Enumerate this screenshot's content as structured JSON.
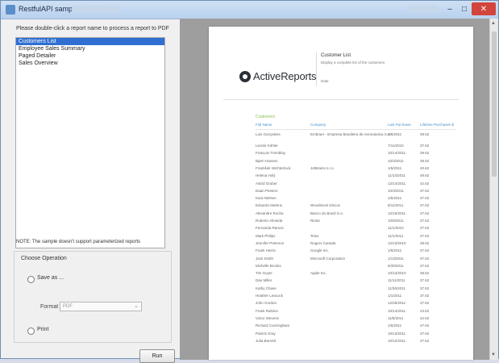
{
  "window": {
    "title": "RestfulAPI sample"
  },
  "left_panel": {
    "instruction": "Please double-click a report name to process a report to PDF",
    "reports": [
      "Customers List",
      "Employee Sales Summary",
      "Paged Detailer",
      "Sales Overview"
    ],
    "selected_index": 0,
    "note": "NOTE: The sample doesn't support parameterized reports",
    "operation": {
      "group_label": "Choose Operation",
      "save_as_label": "Save as ...",
      "format_label": "Format",
      "format_value": "PDF",
      "print_label": "Print"
    },
    "run_label": "Run"
  },
  "preview": {
    "logo_text": "ActiveReports",
    "report_title": "Customer List",
    "report_description": "Display a complete list of the customers",
    "report_date": "Date",
    "section_label": "Customers",
    "columns": [
      "Full Name",
      "Company",
      "Last Purchase",
      "Lifetime Purchases $"
    ],
    "rows": [
      [
        "Luis Gonçalves",
        "Embraer - Empresa Brasileira de Aeronáutica S.A.",
        "3/5/2011",
        "39.62"
      ],
      [
        "Leonie Köhler",
        "",
        "7/11/2010",
        "37.62"
      ],
      [
        "François Tremblay",
        "",
        "10/14/2011",
        "39.62"
      ],
      [
        "Bjørn Hansen",
        "",
        "10/3/2011",
        "39.62"
      ],
      [
        "František Wichterlová",
        "JetBrains s.r.o.",
        "1/6/2011",
        "40.62"
      ],
      [
        "Helena Holý",
        "",
        "11/14/2011",
        "49.62"
      ],
      [
        "Astrid Gruber",
        "",
        "12/14/2011",
        "42.62"
      ],
      [
        "Daan Peeters",
        "",
        "10/3/2011",
        "37.62"
      ],
      [
        "Kara Nielsen",
        "",
        "1/5/2011",
        "37.62"
      ],
      [
        "Eduardo Martins",
        "Woodstock Discos",
        "8/11/2011",
        "37.62"
      ],
      [
        "Alexandre Rocha",
        "Banco do Brasil S.A.",
        "12/16/2011",
        "37.62"
      ],
      [
        "Roberto Almeida",
        "Riotur",
        "10/5/2011",
        "37.62"
      ],
      [
        "Fernanda Ramos",
        "",
        "11/1/2010",
        "37.62"
      ],
      [
        "Mark Philips",
        "Telus",
        "11/1/2011",
        "37.62"
      ],
      [
        "Jennifer Peterson",
        "Rogers Canada",
        "12/13/2010",
        "38.62"
      ],
      [
        "Frank Harris",
        "Google Inc.",
        "1/6/2011",
        "37.62"
      ],
      [
        "Jack Smith",
        "Microsoft Corporation",
        "1/13/2011",
        "37.62"
      ],
      [
        "Michelle Brooks",
        "",
        "5/30/2011",
        "37.62"
      ],
      [
        "Tim Goyer",
        "Apple Inc.",
        "10/13/2010",
        "38.62"
      ],
      [
        "Dan Miller",
        "",
        "11/11/2011",
        "37.62"
      ],
      [
        "Kathy Chase",
        "",
        "11/26/2011",
        "37.62"
      ],
      [
        "Heather Leacock",
        "",
        "1/1/2011",
        "37.62"
      ],
      [
        "John Gordon",
        "",
        "12/29/2011",
        "37.62"
      ],
      [
        "Frank Ralston",
        "",
        "10/14/2011",
        "43.62"
      ],
      [
        "Victor Stevens",
        "",
        "11/5/2011",
        "42.62"
      ],
      [
        "Richard Cunningham",
        "",
        "1/6/2011",
        "47.62"
      ],
      [
        "Patrick Gray",
        "",
        "10/13/2011",
        "37.62"
      ],
      [
        "Julia Barnett",
        "",
        "10/12/2011",
        "37.62"
      ]
    ]
  }
}
